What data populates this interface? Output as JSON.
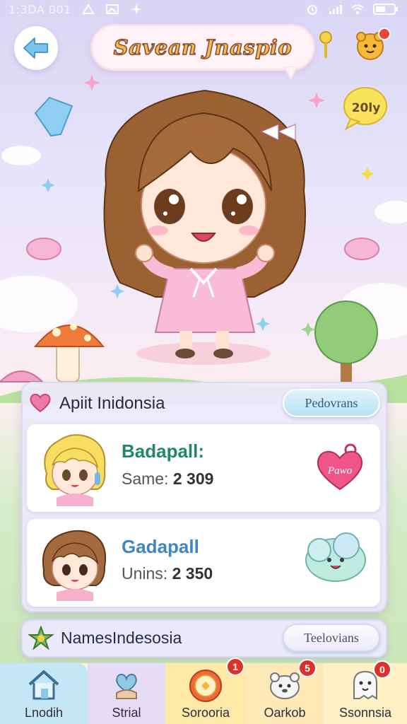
{
  "status_bar": {
    "time": "1:3DA 001"
  },
  "header": {
    "title": "Savean Jnaspio",
    "year_badge": "20ly"
  },
  "panel": {
    "title": "Apiit Inidonsia",
    "button": "Pedovrans",
    "rows": [
      {
        "name": "Badapall:",
        "sub_label": "Same:",
        "sub_value": "2 309",
        "badge_text": "Pawo"
      },
      {
        "name": "Gadapall",
        "sub_label": "Unins:",
        "sub_value": "2 350"
      }
    ]
  },
  "panel2": {
    "title": "NamesIndesosia",
    "button": "Teelovians"
  },
  "nav": {
    "items": [
      {
        "label": "Lnodih"
      },
      {
        "label": "Strial"
      },
      {
        "label": "Sorooria",
        "badge": "1"
      },
      {
        "label": "Oarkob",
        "badge": "5"
      },
      {
        "label": "Ssonnsia",
        "badge": "0"
      }
    ]
  }
}
